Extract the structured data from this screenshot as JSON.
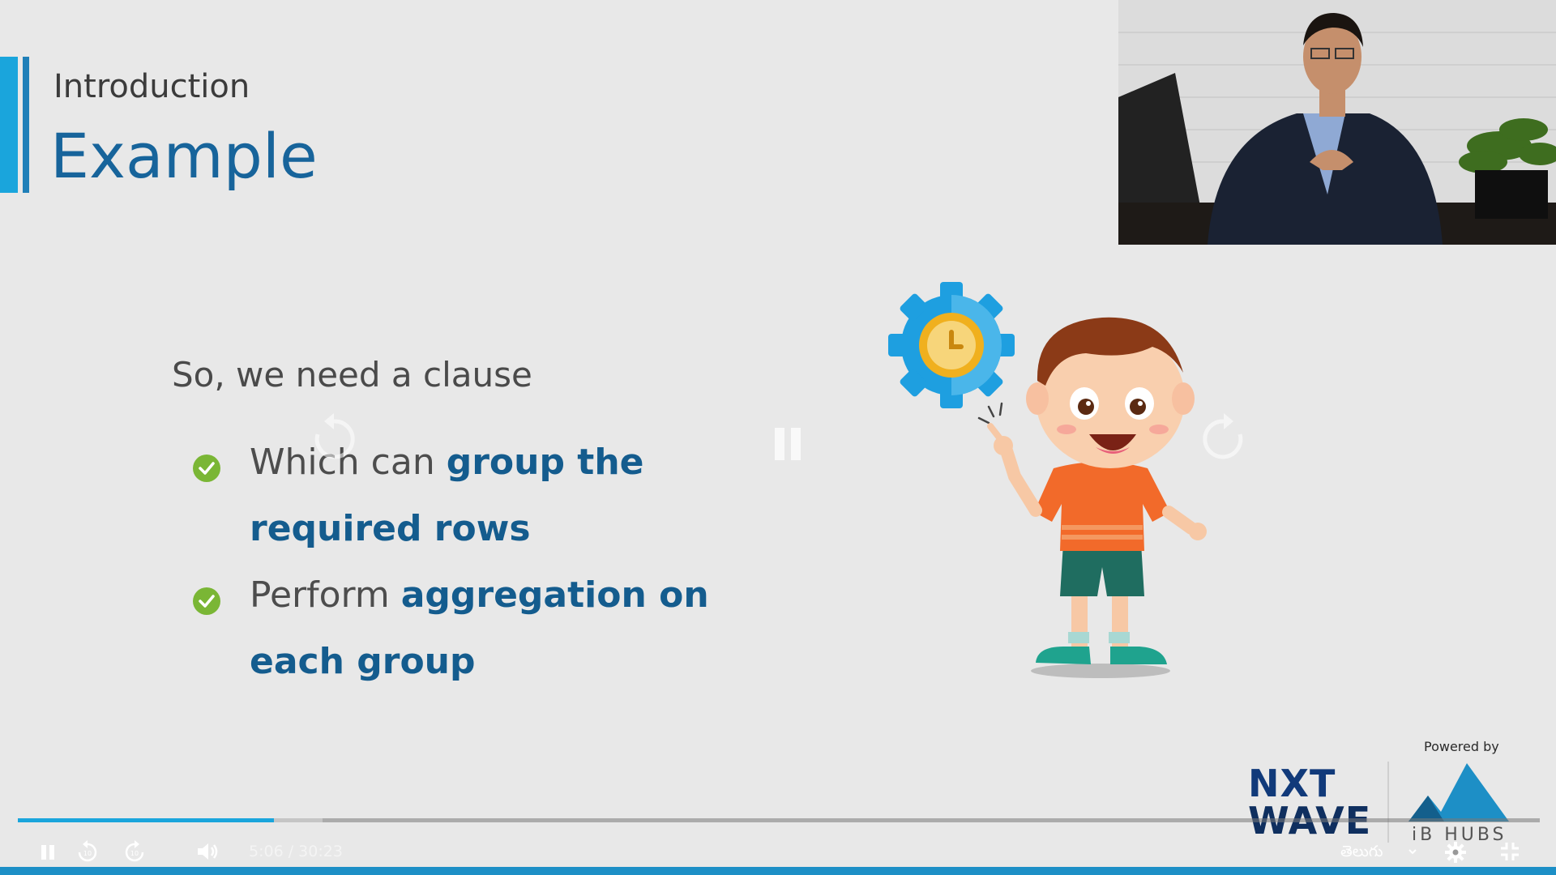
{
  "slide": {
    "section_label": "Introduction",
    "title": "Example",
    "lead": "So, we need a clause",
    "bullets": [
      {
        "plain": "Which can ",
        "highlight": "group the required rows"
      },
      {
        "plain": "Perform ",
        "highlight": "aggregation on each group"
      }
    ]
  },
  "brand": {
    "powered_by": "Powered by",
    "logo_line1": "NXT",
    "logo_line2": "WAVE",
    "partner": "iB HUBS"
  },
  "player": {
    "current_time": "5:06",
    "separator": "/",
    "duration": "30:23",
    "progress_fraction": 0.168,
    "language": "తెలుగు",
    "skip_seconds": "10"
  },
  "colors": {
    "accent": "#1aa5dc",
    "title": "#17649b",
    "check": "#7ab635"
  }
}
